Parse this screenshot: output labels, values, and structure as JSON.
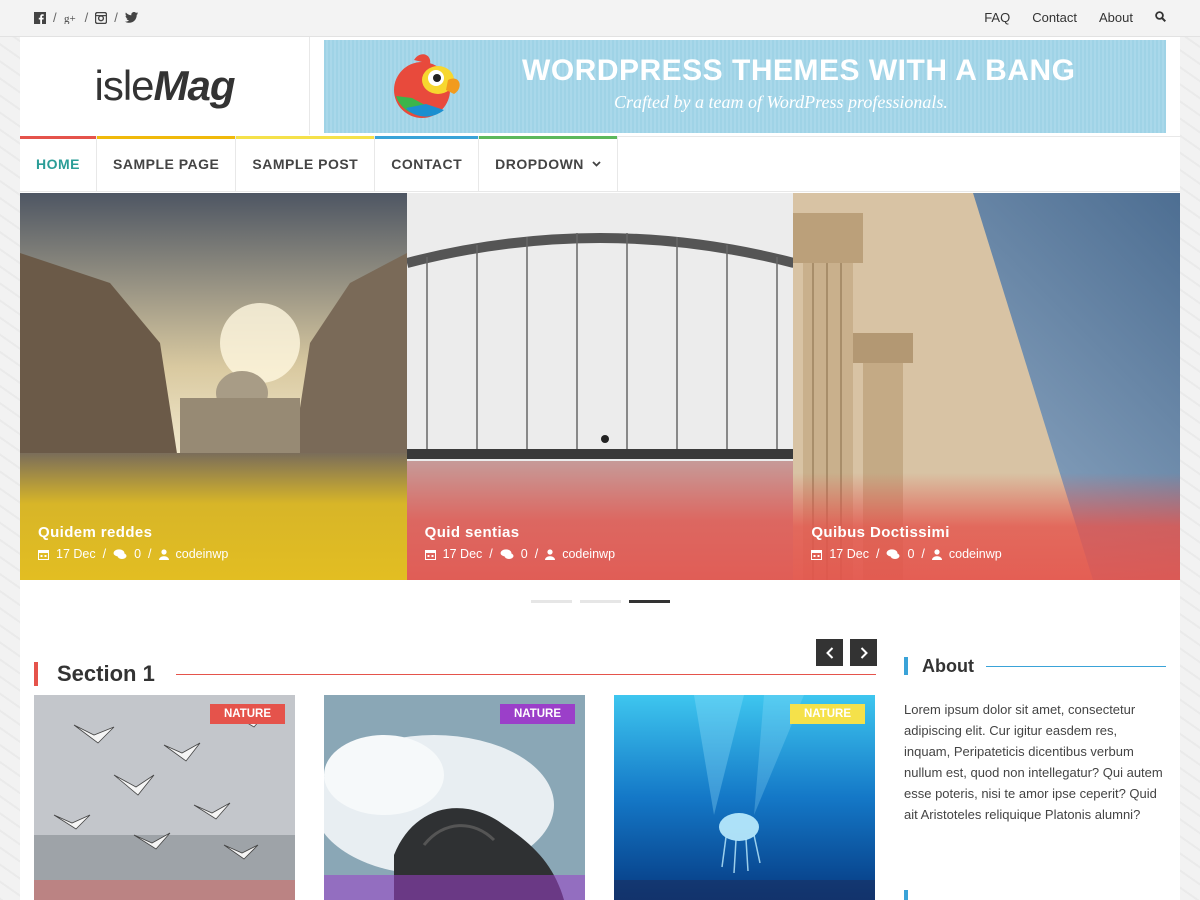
{
  "topbar": {
    "social_icons": [
      "facebook-icon",
      "google-plus-icon",
      "instagram-icon",
      "twitter-icon"
    ],
    "links": [
      "FAQ",
      "Contact",
      "About"
    ],
    "search_icon": "search-icon"
  },
  "header": {
    "logo_prefix": "isle",
    "logo_suffix": "Mag",
    "banner": {
      "title": "WORDPRESS THEMES WITH A BANG",
      "subtitle": "Crafted by a team of WordPress professionals."
    }
  },
  "nav": {
    "items": [
      {
        "label": "HOME",
        "color": "#e5534b",
        "active": true
      },
      {
        "label": "SAMPLE PAGE",
        "color": "#f0b90b"
      },
      {
        "label": "SAMPLE POST",
        "color": "#f5e14a"
      },
      {
        "label": "CONTACT",
        "color": "#3aa3d8"
      },
      {
        "label": "DROPDOWN",
        "color": "#5cb85c"
      }
    ]
  },
  "slider": {
    "slides": [
      {
        "title": "Quidem reddes",
        "date": "17 Dec",
        "comments": "0",
        "author": "codeinwp",
        "overlay": "#e8c21f"
      },
      {
        "title": "Quid sentias",
        "date": "17 Dec",
        "comments": "0",
        "author": "codeinwp",
        "overlay": "#e5534b"
      },
      {
        "title": "Quibus Doctissimi",
        "date": "17 Dec",
        "comments": "0",
        "author": "codeinwp",
        "overlay": "#e5534b"
      }
    ],
    "active_dot": 3
  },
  "section": {
    "title": "Section 1",
    "prev": "‹",
    "next": "›",
    "cards": [
      {
        "badge": "NATURE",
        "badge_color": "#e5534b"
      },
      {
        "badge": "NATURE",
        "badge_color": "#9b3fc9"
      },
      {
        "badge": "NATURE",
        "badge_color": "#f5e14a"
      }
    ]
  },
  "sidebar": {
    "title": "About",
    "text": "Lorem ipsum dolor sit amet, consectetur adipiscing elit. Cur igitur easdem res, inquam, Peripateticis dicentibus verbum nullum est, quod non intellegatur? Qui autem esse poteris, nisi te amor ipse ceperit? Quid ait Aristoteles reliquique Platonis alumni?"
  }
}
